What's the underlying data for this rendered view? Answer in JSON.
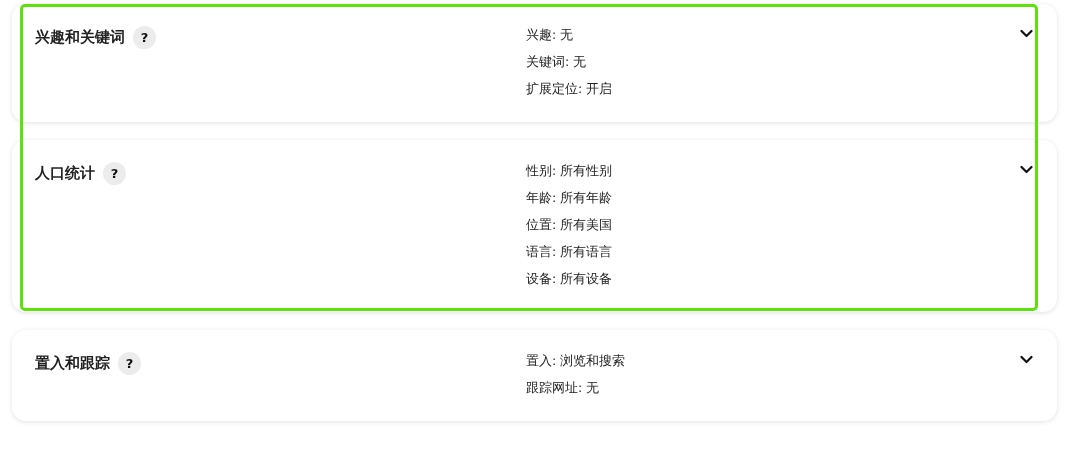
{
  "sections": [
    {
      "title": "兴趣和关键词",
      "help": "?",
      "highlighted": true,
      "details": [
        "兴趣: 无",
        "关键词: 无",
        "扩展定位: 开启"
      ],
      "expanded": false
    },
    {
      "title": "人口统计",
      "help": "?",
      "highlighted": true,
      "details": [
        "性别: 所有性别",
        "年龄: 所有年龄",
        "位置: 所有美国",
        "语言: 所有语言",
        "设备: 所有设备"
      ],
      "expanded": false
    },
    {
      "title": "置入和跟踪",
      "help": "?",
      "highlighted": false,
      "details": [
        "置入: 浏览和搜索",
        "跟踪网址: 无"
      ],
      "expanded": false
    }
  ]
}
